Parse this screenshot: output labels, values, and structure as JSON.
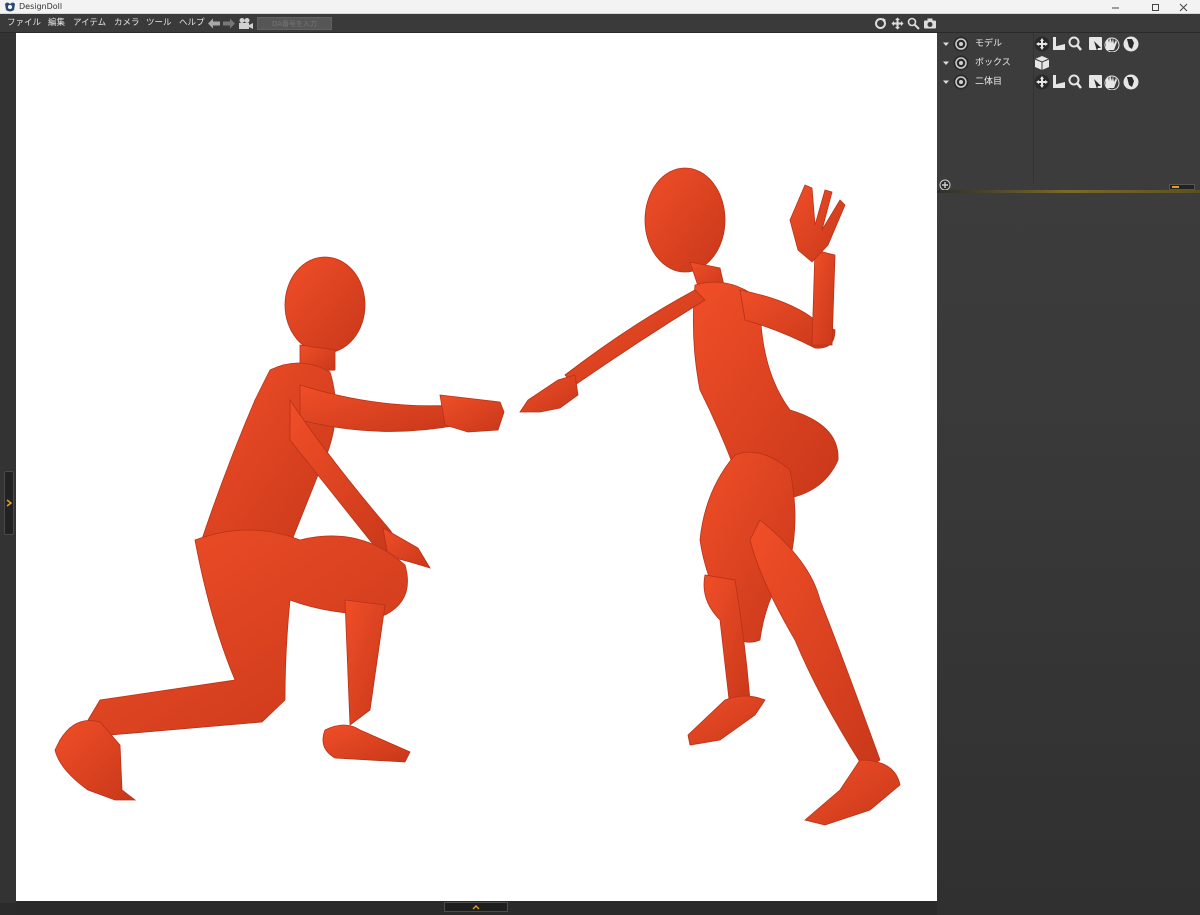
{
  "window": {
    "title": "DesignDoll",
    "controls": [
      "minimize-icon",
      "maximize-icon",
      "close-icon"
    ]
  },
  "menu": {
    "items": [
      "ファイル",
      "編集",
      "アイテム",
      "カメラ",
      "ツール",
      "ヘルプ"
    ]
  },
  "toolbar": {
    "da_input_placeholder": "DA番号を入力",
    "nav_icons": [
      "back-arrow-icon",
      "forward-arrow-icon",
      "camera-movie-icon"
    ],
    "right_icons": [
      "rotate-icon",
      "move-icon",
      "zoom-icon",
      "screenshot-camera-icon"
    ]
  },
  "scene": {
    "items": [
      {
        "label": "モデル",
        "tools": [
          "move-icon",
          "ik-icon",
          "zoom-icon",
          "select-icon",
          "hand-open-icon",
          "hand-grip-icon"
        ]
      },
      {
        "label": "ボックス",
        "tools": [
          "box-icon"
        ]
      },
      {
        "label": "二体目",
        "tools": [
          "move-icon",
          "ik-icon",
          "zoom-icon",
          "select-icon",
          "hand-open-icon",
          "hand-grip-icon"
        ]
      }
    ]
  },
  "viewport": {
    "background": "#ffffff",
    "figure_color": "#e04422",
    "figures": [
      "kneeling-figure",
      "standing-figure"
    ]
  },
  "colors": {
    "accent": "#e0a020",
    "panel": "#3c3c3c",
    "menubar": "#3a3a3a"
  }
}
